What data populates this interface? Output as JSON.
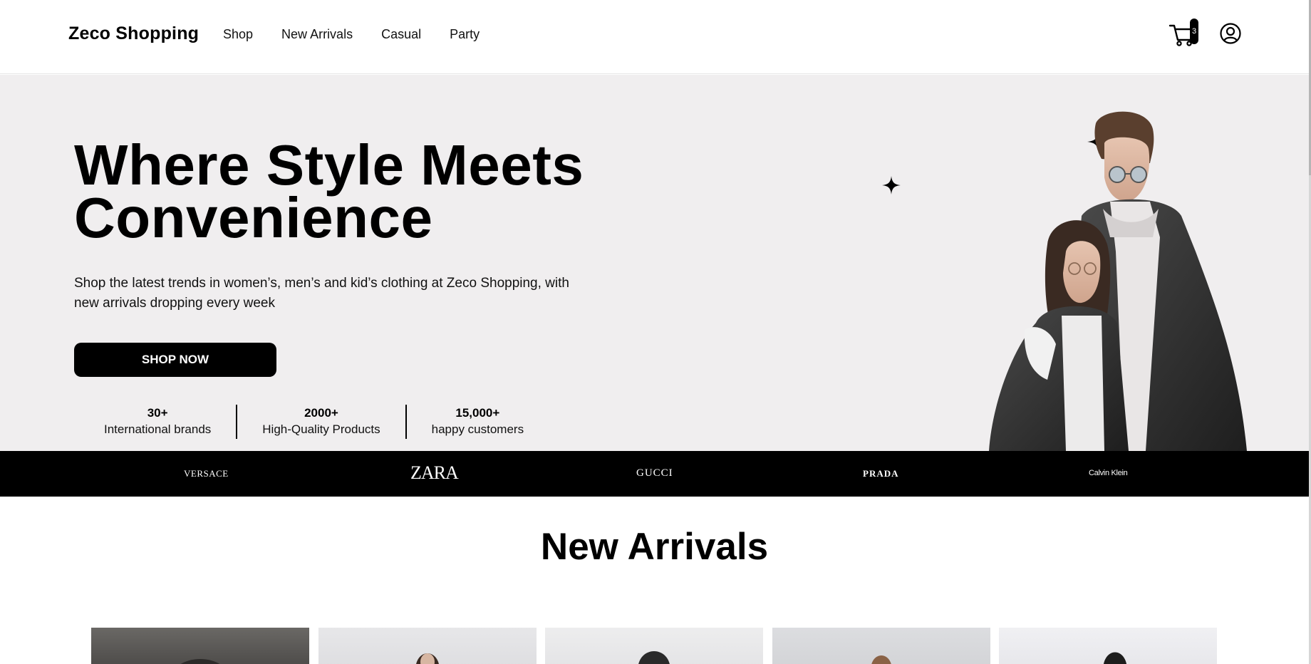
{
  "header": {
    "logo": "Zeco Shopping",
    "nav": [
      "Shop",
      "New Arrivals",
      "Casual",
      "Party"
    ],
    "cart_icon": "cart-icon",
    "cart_count": "3",
    "user_icon": "user-circle-icon"
  },
  "hero": {
    "title_line1": "Where Style Meets",
    "title_line2": "Convenience",
    "subtitle": "Shop the latest trends in women’s, men’s and kid’s clothing at Zeco Shopping, with new arrivals dropping every week",
    "cta": "SHOP NOW",
    "stats": [
      {
        "value": "30+",
        "label": "International brands"
      },
      {
        "value": "2000+",
        "label": "High-Quality Products"
      },
      {
        "value": "15,000+",
        "label": "happy customers"
      }
    ]
  },
  "brands": [
    "VERSACE",
    "ZARA",
    "GUCCI",
    "PRADA",
    "Calvin Klein"
  ],
  "new_arrivals": {
    "title": "New Arrivals",
    "products": [
      "product-1",
      "product-2",
      "product-3",
      "product-4",
      "product-5"
    ]
  },
  "colors": {
    "hero_bg": "#f0eeef",
    "accent": "#000000",
    "text": "#000000"
  }
}
